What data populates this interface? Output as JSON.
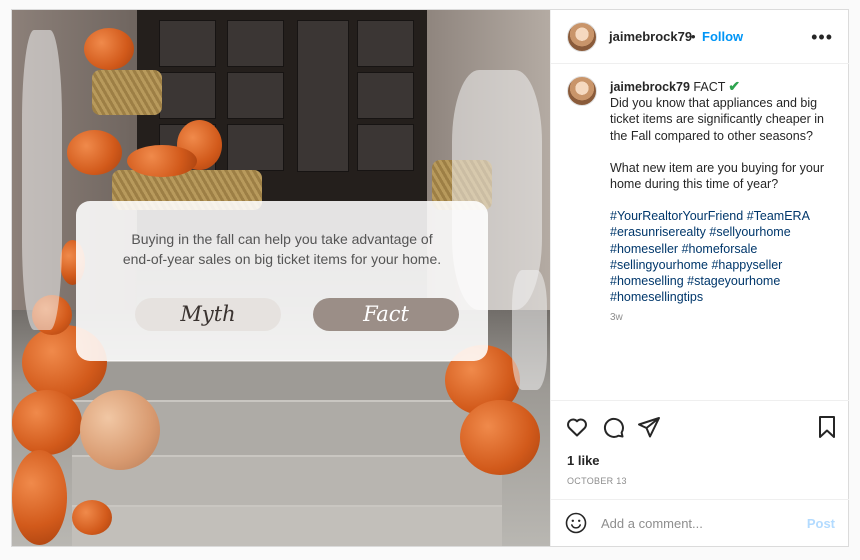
{
  "post": {
    "overlay_text_line1": "Buying in the fall can help you take advantage of",
    "overlay_text_line2": "end-of-year sales on big ticket items for your home.",
    "myth_label": "Myth",
    "fact_label": "Fact"
  },
  "header": {
    "username": "jaimebrock79",
    "separator": "•",
    "follow_label": "Follow",
    "more_icon": "more-horizontal-icon"
  },
  "caption": {
    "username": "jaimebrock79",
    "first_word": "FACT",
    "line1": "Did you know that appliances and big ticket items are significantly cheaper in the Fall compared to other seasons?",
    "line2": "What new item are you buying for your home during this time of year?",
    "hashtags": [
      "#YourRealtorYourFriend",
      "#TeamERA",
      "#erasunriserealty",
      "#sellyourhome",
      "#homeseller",
      "#homeforsale",
      "#sellingyourhome",
      "#happyseller",
      "#homeselling",
      "#stageyourhome",
      "#homesellingtips"
    ],
    "time_ago": "3w"
  },
  "actions": {
    "likes": "1 like",
    "date": "OCTOBER 13"
  },
  "comment": {
    "placeholder": "Add a comment...",
    "post_label": "Post"
  },
  "colors": {
    "accent": "#0095f6",
    "verified": "#2ea44f",
    "fact_button": "#9b8e87",
    "myth_button": "#e6e2df"
  }
}
